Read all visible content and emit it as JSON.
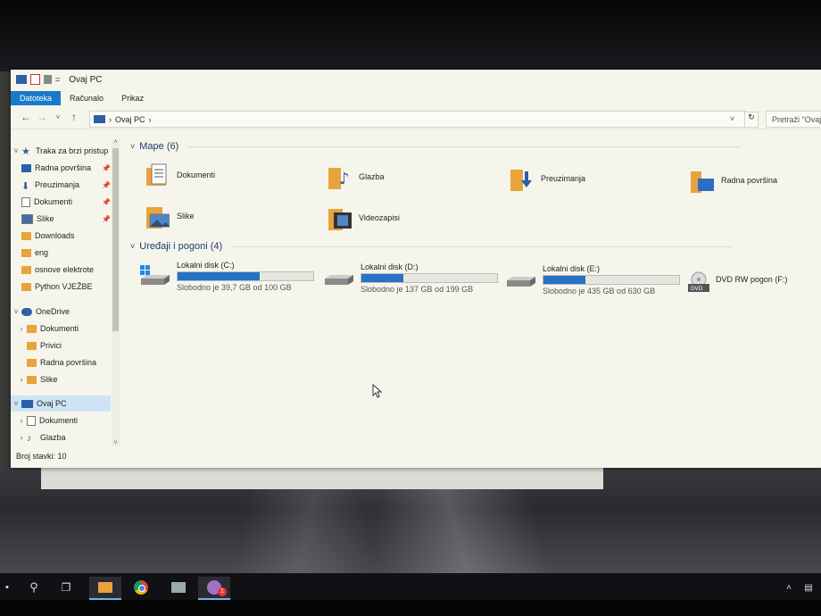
{
  "window": {
    "title": "Ovaj PC"
  },
  "ribbon": {
    "tabs": [
      {
        "label": "Datoteka",
        "active": true
      },
      {
        "label": "Računalo",
        "active": false
      },
      {
        "label": "Prikaz",
        "active": false
      }
    ]
  },
  "address": {
    "crumb": "Ovaj PC",
    "separator": "›",
    "search_placeholder": "Pretraži \"Ovaj"
  },
  "nav": {
    "quick_access": "Traka za brzi pristup",
    "items": [
      {
        "label": "Radna površina",
        "icon": "desktop-icon",
        "pinned": true
      },
      {
        "label": "Preuzimanja",
        "icon": "download-icon",
        "pinned": true
      },
      {
        "label": "Dokumenti",
        "icon": "document-icon",
        "pinned": true
      },
      {
        "label": "Slike",
        "icon": "pictures-icon",
        "pinned": true
      },
      {
        "label": "Downloads",
        "icon": "folder-icon",
        "pinned": false
      },
      {
        "label": "eng",
        "icon": "folder-icon",
        "pinned": false
      },
      {
        "label": "osnove elektrote",
        "icon": "folder-icon",
        "pinned": false
      },
      {
        "label": "Python VJEŽBE",
        "icon": "folder-icon",
        "pinned": false
      }
    ],
    "onedrive": "OneDrive",
    "onedrive_items": [
      "Dokumenti",
      "Privici",
      "Radna površina",
      "Slike"
    ],
    "this_pc": "Ovaj PC",
    "this_pc_items": [
      "Dokumenti",
      "Glazba"
    ]
  },
  "status": {
    "count": "Broj stavki: 10"
  },
  "groups": {
    "folders": "Mape (6)",
    "devices": "Uređaji i pogoni (4)"
  },
  "folders": [
    {
      "label": "Dokumenti",
      "icon": "documents-folder-icon"
    },
    {
      "label": "Glazba",
      "icon": "music-folder-icon"
    },
    {
      "label": "Preuzimanja",
      "icon": "downloads-folder-icon"
    },
    {
      "label": "Radna površina",
      "icon": "desktop-folder-icon"
    },
    {
      "label": "Slike",
      "icon": "pictures-folder-icon"
    },
    {
      "label": "Videozapisi",
      "icon": "videos-folder-icon"
    }
  ],
  "drives": [
    {
      "label": "Lokalni disk (C:)",
      "free": "Slobodno je 39,7 GB od 100 GB",
      "used_fraction": 0.603
    },
    {
      "label": "Lokalni disk (D:)",
      "free": "Slobodno je 137 GB od 199 GB",
      "used_fraction": 0.312
    },
    {
      "label": "Lokalni disk (E:)",
      "free": "Slobodno je 435 GB od 630 GB",
      "used_fraction": 0.31
    },
    {
      "label": "DVD RW pogon (F:)",
      "free": "",
      "used_fraction": null
    }
  ],
  "dvd_badge": "DVD",
  "notification_count": "1",
  "colors": {
    "accent": "#1979ca",
    "drive_fill": "#2672c4",
    "folder": "#e8a33c"
  }
}
